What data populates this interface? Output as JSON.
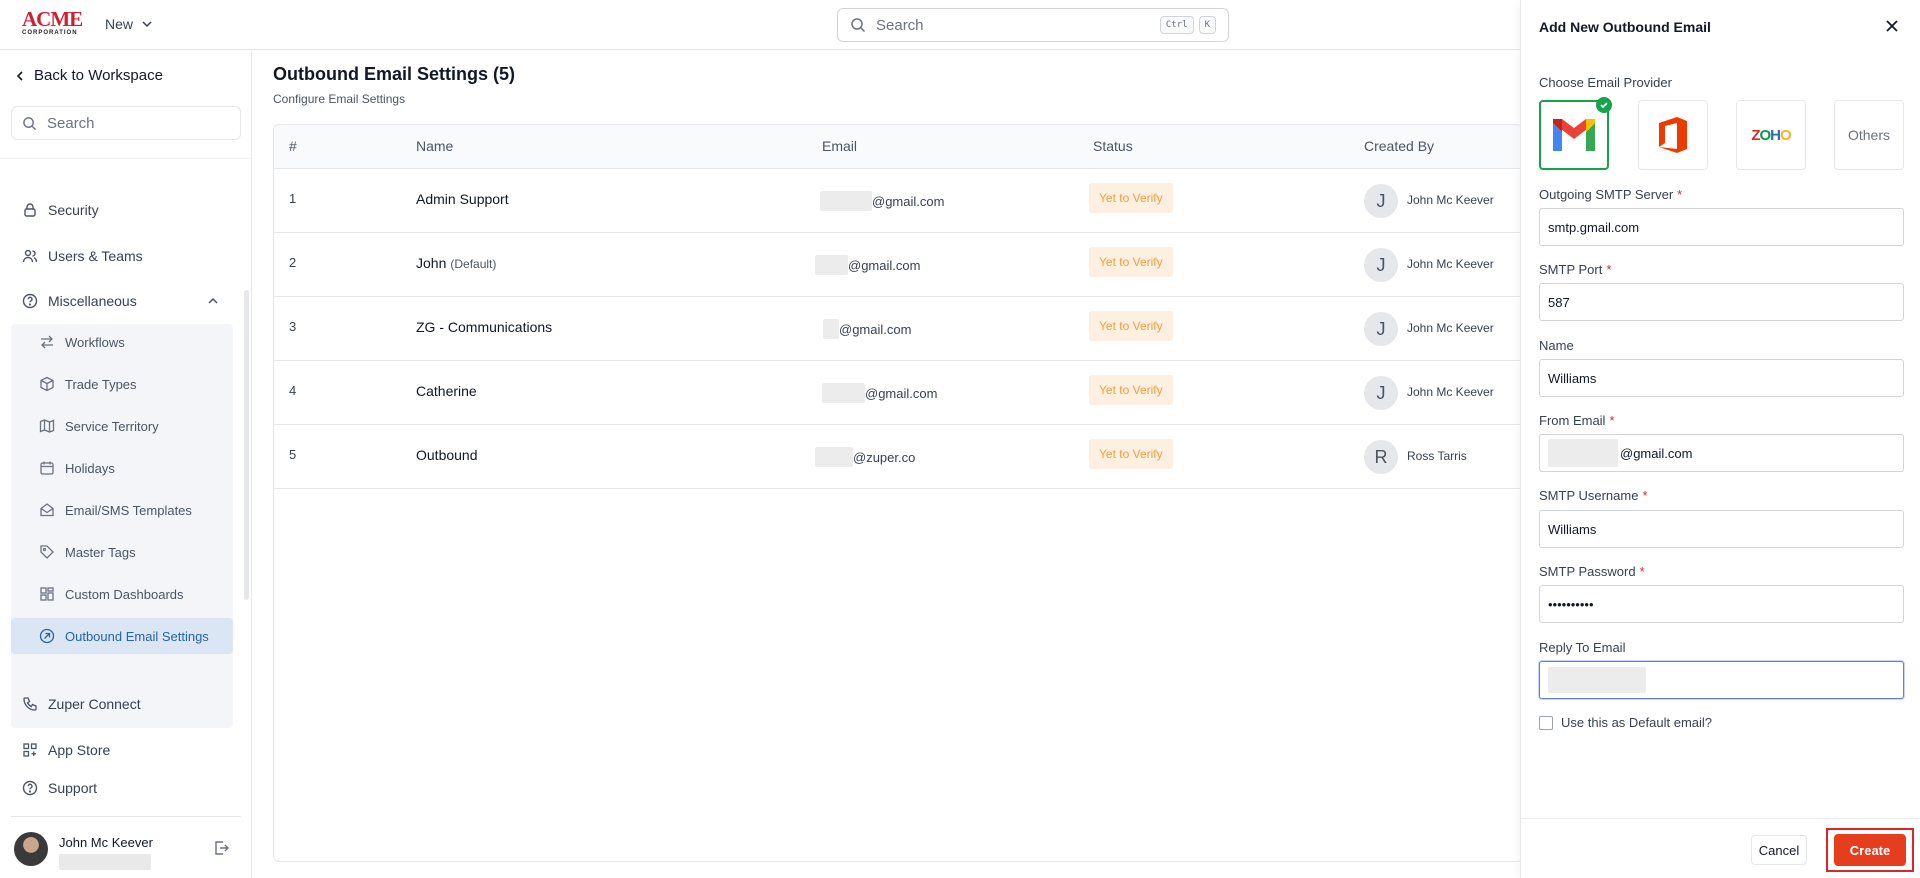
{
  "brand": {
    "logo_main": "ACME",
    "logo_sub": "CORPORATION",
    "accent": "#e53e1f"
  },
  "topbar": {
    "new_label": "New",
    "search_placeholder": "Search",
    "shortcut_ctrl": "Ctrl",
    "shortcut_key": "K"
  },
  "sidebar": {
    "back_label": "Back to Workspace",
    "search_placeholder": "Search",
    "items": [
      {
        "label": "Security",
        "icon": "lock-icon"
      },
      {
        "label": "Users & Teams",
        "icon": "users-icon"
      },
      {
        "label": "Miscellaneous",
        "icon": "help-circle-icon"
      }
    ],
    "submenu": [
      {
        "label": "Workflows",
        "icon": "workflow-icon"
      },
      {
        "label": "Trade Types",
        "icon": "box-icon"
      },
      {
        "label": "Service Territory",
        "icon": "map-icon"
      },
      {
        "label": "Holidays",
        "icon": "calendar-icon"
      },
      {
        "label": "Email/SMS Templates",
        "icon": "mail-open-icon"
      },
      {
        "label": "Master Tags",
        "icon": "tag-icon"
      },
      {
        "label": "Custom Dashboards",
        "icon": "dashboard-icon"
      },
      {
        "label": "Outbound Email Settings",
        "icon": "outbound-icon",
        "active": true
      }
    ],
    "bottom_items": [
      {
        "label": "Zuper Connect",
        "icon": "phone-icon"
      },
      {
        "label": "App Store",
        "icon": "apps-icon"
      },
      {
        "label": "Support",
        "icon": "help-circle-icon"
      }
    ],
    "user_name": "John Mc Keever"
  },
  "main": {
    "title": "Outbound Email Settings (5)",
    "subtitle": "Configure Email Settings",
    "columns": [
      "#",
      "Name",
      "Email",
      "Status",
      "Created By"
    ],
    "rows": [
      {
        "num": "1",
        "name": "Admin Support",
        "default_tag": "",
        "email_suffix": "@gmail.com",
        "status": "Yet to Verify",
        "creator_initial": "J",
        "creator": "John Mc Keever"
      },
      {
        "num": "2",
        "name": "John",
        "default_tag": "(Default)",
        "email_suffix": "@gmail.com",
        "status": "Yet to Verify",
        "creator_initial": "J",
        "creator": "John Mc Keever"
      },
      {
        "num": "3",
        "name": "ZG - Communications",
        "default_tag": "",
        "email_suffix": "@gmail.com",
        "status": "Yet to Verify",
        "creator_initial": "J",
        "creator": "John Mc Keever"
      },
      {
        "num": "4",
        "name": "Catherine",
        "default_tag": "",
        "email_suffix": "@gmail.com",
        "status": "Yet to Verify",
        "creator_initial": "J",
        "creator": "John Mc Keever"
      },
      {
        "num": "5",
        "name": "Outbound",
        "default_tag": "",
        "email_suffix": "@zuper.co",
        "status": "Yet to Verify",
        "creator_initial": "R",
        "creator": "Ross Tarris"
      }
    ]
  },
  "drawer": {
    "title": "Add New Outbound Email",
    "provider_label": "Choose Email Provider",
    "providers": [
      {
        "name": "gmail-icon",
        "selected": true
      },
      {
        "name": "office-icon",
        "selected": false
      },
      {
        "name": "zoho-logo",
        "selected": false
      },
      {
        "label": "Others",
        "selected": false
      }
    ],
    "zoho_text": "ZOHO",
    "smtp_server_label": "Outgoing SMTP Server",
    "smtp_server_value": "smtp.gmail.com",
    "smtp_port_label": "SMTP Port",
    "smtp_port_value": "587",
    "name_label": "Name",
    "name_value": "Williams",
    "from_email_label": "From Email",
    "from_email_suffix": "@gmail.com",
    "smtp_username_label": "SMTP Username",
    "smtp_username_value": "Williams",
    "smtp_password_label": "SMTP Password",
    "smtp_password_value": "••••••••••",
    "reply_to_label": "Reply To Email",
    "default_checkbox_label": "Use this as Default email?",
    "required_mark": "*",
    "cancel_label": "Cancel",
    "create_label": "Create"
  }
}
